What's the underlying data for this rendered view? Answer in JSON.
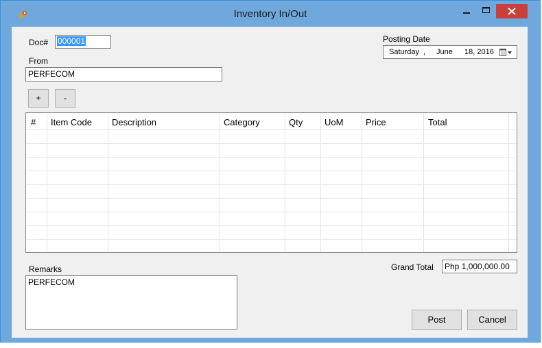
{
  "window": {
    "title": "Inventory In/Out",
    "accent_color": "#6fa8dc",
    "close_color": "#c7413a",
    "icons": [
      "app-icon",
      "minimize-icon",
      "maximize-icon",
      "close-icon"
    ]
  },
  "form": {
    "doc_label": "Doc#",
    "doc_value": "000001",
    "from_label": "From",
    "from_value": "PERFECOM",
    "posting_date_label": "Posting Date",
    "posting_date": {
      "day": "Saturday",
      "sep": ",",
      "month": "June",
      "date": "18, 2016"
    },
    "add_label": "+",
    "remove_label": "-"
  },
  "grid": {
    "columns": [
      "#",
      "Item Code",
      "Description",
      "Category",
      "Qty",
      "UoM",
      "Price",
      "Total"
    ],
    "rows": []
  },
  "footer": {
    "remarks_label": "Remarks",
    "remarks_value": "PERFECOM",
    "grand_total_label": "Grand Total",
    "grand_total_value": "Php 1,000,000.00",
    "post_label": "Post",
    "cancel_label": "Cancel"
  }
}
